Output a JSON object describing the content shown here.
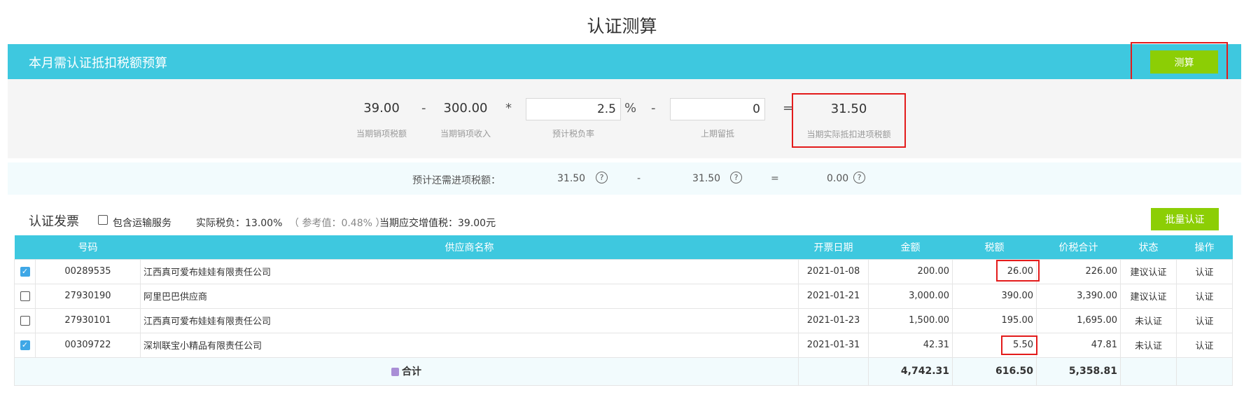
{
  "page": {
    "title": "认证测算"
  },
  "budget": {
    "title": "本月需认证抵扣税额预算",
    "calc_label": "测算",
    "formula": {
      "output_tax": "39.00",
      "output_tax_label": "当期销项税额",
      "minus1": "-",
      "sales_income": "300.00",
      "sales_income_label": "当期销项收入",
      "times": "*",
      "rate_value": "2.5",
      "percent": "%",
      "rate_label": "预计税负率",
      "minus2": "-",
      "carryover_value": "0",
      "carryover_label": "上期留抵",
      "equals": "=",
      "result": "31.50",
      "result_label": "当期实际抵扣进项税额"
    }
  },
  "estimate": {
    "label": "预计还需进项税额：",
    "v1": "31.50",
    "minus": "-",
    "v2": "31.50",
    "equals": "=",
    "v3": "0.00",
    "help": "?"
  },
  "invoices": {
    "title": "认证发票",
    "include_transport": "包含运输服务",
    "actual_tax": "实际税负：13.00%",
    "reference": "（ 参考值：0.48% ）",
    "vat_payable": "当期应交增值税：39.00元",
    "batch_label": "批量认证",
    "columns": [
      "号码",
      "供应商名称",
      "开票日期",
      "金额",
      "税额",
      "价税合计",
      "状态",
      "操作"
    ],
    "rows": [
      {
        "checked": true,
        "number": "00289535",
        "supplier": "江西真可爱布娃娃有限责任公司",
        "date": "2021-01-08",
        "amount": "200.00",
        "tax": "26.00",
        "total": "226.00",
        "status": "建议认证",
        "action": "认证"
      },
      {
        "checked": false,
        "number": "27930190",
        "supplier": "阿里巴巴供应商",
        "date": "2021-01-21",
        "amount": "3,000.00",
        "tax": "390.00",
        "total": "3,390.00",
        "status": "建议认证",
        "action": "认证"
      },
      {
        "checked": false,
        "number": "27930101",
        "supplier": "江西真可爱布娃娃有限责任公司",
        "date": "2021-01-23",
        "amount": "1,500.00",
        "tax": "195.00",
        "total": "1,695.00",
        "status": "未认证",
        "action": "认证"
      },
      {
        "checked": true,
        "number": "00309722",
        "supplier": "深圳联宝小精品有限责任公司",
        "date": "2021-01-31",
        "amount": "42.31",
        "tax": "5.50",
        "total": "47.81",
        "status": "未认证",
        "action": "认证"
      }
    ],
    "totals": {
      "label": "合计",
      "amount": "4,742.31",
      "tax": "616.50",
      "total": "5,358.81"
    },
    "colors": {
      "header": "#3ec8df",
      "button": "#8cce05",
      "suggest": "#f39800",
      "highlight": "#e31b1b"
    }
  }
}
